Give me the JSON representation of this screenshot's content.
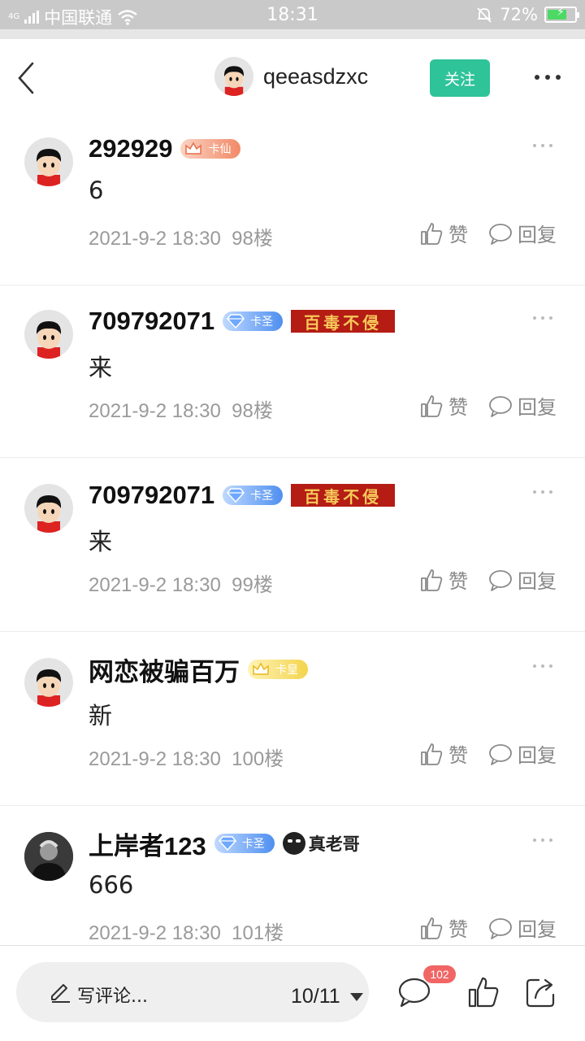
{
  "status_bar": {
    "network": "4G",
    "carrier": "中国联通",
    "time": "18:31",
    "battery_percent": "72%",
    "battery_level": 0.72,
    "battery_color": "#4cd964"
  },
  "nav": {
    "back_icon": "chevron-left-icon",
    "username": "qeeasdzxc",
    "follow_label": "关注",
    "follow_color": "#2fc39a",
    "more_icon": "more-horizontal-icon"
  },
  "comments": [
    {
      "username": "292929",
      "badge": "卡仙",
      "title": "",
      "text": "6",
      "time": "2021-9-2 18:30",
      "floor": "98楼",
      "like_label": "赞",
      "reply_label": "回复"
    },
    {
      "username": "709792071",
      "badge": "卡圣",
      "title": "百毒不侵",
      "text": "来",
      "time": "2021-9-2 18:30",
      "floor": "98楼",
      "like_label": "赞",
      "reply_label": "回复"
    },
    {
      "username": "709792071",
      "badge": "卡圣",
      "title": "百毒不侵",
      "text": "来",
      "time": "2021-9-2 18:30",
      "floor": "99楼",
      "like_label": "赞",
      "reply_label": "回复"
    },
    {
      "username": "网恋被骗百万",
      "badge": "卡皇",
      "title": "",
      "text": "新",
      "time": "2021-9-2 18:30",
      "floor": "100楼",
      "like_label": "赞",
      "reply_label": "回复"
    },
    {
      "username": "上岸者123",
      "badge": "卡圣",
      "title": "真老哥",
      "text": "666",
      "time": "2021-9-2 18:30",
      "floor": "101楼",
      "like_label": "赞",
      "reply_label": "回复"
    }
  ],
  "bottom_bar": {
    "comment_placeholder": "写评论...",
    "page_indicator": "10/11",
    "comment_count": "102",
    "badge_color": "#f16565"
  }
}
